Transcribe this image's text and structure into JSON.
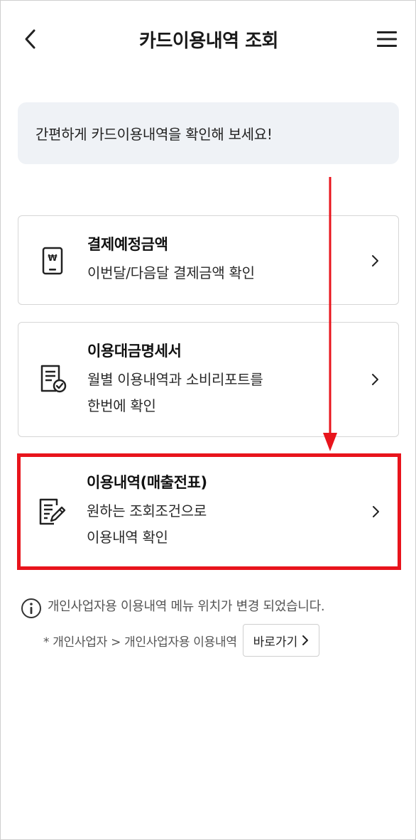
{
  "header": {
    "title": "카드이용내역 조회",
    "back_icon": "chevron-left-icon",
    "menu_icon": "hamburger-menu-icon"
  },
  "notice": {
    "text": "간편하게 카드이용내역을 확인해 보세요!"
  },
  "cards": [
    {
      "title": "결제예정금액",
      "desc": "이번달/다음달 결제금액 확인",
      "icon": "phone-won-icon"
    },
    {
      "title": "이용대금명세서",
      "desc": "월별 이용내역과 소비리포트를\n한번에 확인",
      "icon": "statement-check-icon"
    },
    {
      "title": "이용내역(매출전표)",
      "desc": "원하는 조회조건으로\n이용내역 확인",
      "icon": "document-edit-icon"
    }
  ],
  "info": {
    "message": "개인사업자용 이용내역 메뉴 위치가 변경 되었습니다.",
    "path": "* 개인사업자 > 개인사업자용 이용내역",
    "goto_label": "바로가기",
    "icon": "info-circle-icon"
  },
  "annotation": {
    "highlight_color": "#e8141c",
    "arrow_color": "#e8141c"
  }
}
